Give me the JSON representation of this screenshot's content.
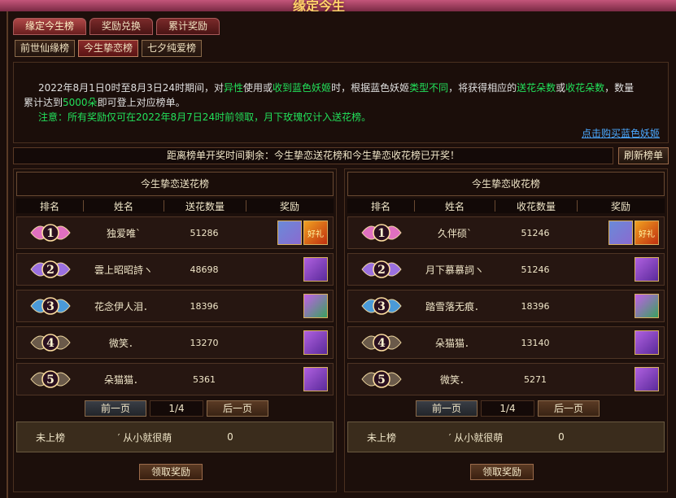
{
  "banner_title": "缘定今生",
  "tabs_primary": [
    {
      "label": "缘定今生榜",
      "active": true
    },
    {
      "label": "奖励兑换",
      "active": false
    },
    {
      "label": "累计奖励",
      "active": false
    }
  ],
  "tabs_secondary": [
    {
      "label": "前世仙缘榜",
      "active": false
    },
    {
      "label": "今生挚恋榜",
      "active": true
    },
    {
      "label": "七夕纯爱榜",
      "active": false
    }
  ],
  "info": {
    "line1_a": "2022年8月1日0时至8月3日24时期间，对",
    "line1_b": "异性",
    "line1_c": "使用",
    "line1_d": "或",
    "line1_e": "收到",
    "line1_f": "蓝色妖姬",
    "line1_g": "时，根据蓝色妖姬",
    "line1_h": "类型不同",
    "line1_i": "，将获得相应的",
    "line1_j": "送花朵数",
    "line1_k": "或",
    "line1_l": "收花朵数",
    "line1_m": "，数量",
    "line2_a": "累计达到",
    "line2_b": "5000朵",
    "line2_c": "即可登上对应榜单。",
    "line3": "注意：所有奖励仅可在2022年8月7日24时前领取，月下玫瑰仅计入送花榜。",
    "buy_link": "点击购买蓝色妖姬"
  },
  "countdown_text": "距离榜单开奖时间剩余：今生挚恋送花榜和今生挚恋收花榜已开奖！",
  "refresh_label": "刷新榜单",
  "panels": [
    {
      "title": "今生挚恋送花榜",
      "headers": [
        "排名",
        "姓名",
        "送花数量",
        "奖励"
      ],
      "rows": [
        {
          "rank": "1",
          "name": "独爱唯ˋ",
          "count": "51286",
          "rewards": [
            "gold",
            "fire"
          ]
        },
        {
          "rank": "2",
          "name": "雲上昭昭詩ヽ",
          "count": "48698",
          "rewards": [
            "box"
          ]
        },
        {
          "rank": "3",
          "name": "花念伊人泪．",
          "count": "18396",
          "rewards": [
            "green"
          ]
        },
        {
          "rank": "4",
          "name": "微笑．",
          "count": "13270",
          "rewards": [
            "box"
          ]
        },
        {
          "rank": "5",
          "name": "朵猫猫．",
          "count": "5361",
          "rewards": [
            "box"
          ]
        }
      ],
      "pager": {
        "prev": "前一页",
        "page": "1/4",
        "next": "后一页"
      },
      "self": {
        "status": "未上榜",
        "name": "′ 从小就很萌",
        "count": "0"
      },
      "claim": "领取奖励"
    },
    {
      "title": "今生挚恋收花榜",
      "headers": [
        "排名",
        "姓名",
        "收花数量",
        "奖励"
      ],
      "rows": [
        {
          "rank": "1",
          "name": "久伴硕ˋ",
          "count": "51246",
          "rewards": [
            "gold",
            "fire"
          ]
        },
        {
          "rank": "2",
          "name": "月下慕慕詞ヽ",
          "count": "51246",
          "rewards": [
            "box"
          ]
        },
        {
          "rank": "3",
          "name": "踏雪落无痕．",
          "count": "18396",
          "rewards": [
            "green"
          ]
        },
        {
          "rank": "4",
          "name": "朵猫猫．",
          "count": "13140",
          "rewards": [
            "box"
          ]
        },
        {
          "rank": "5",
          "name": "微笑．",
          "count": "5271",
          "rewards": [
            "box"
          ]
        }
      ],
      "pager": {
        "prev": "前一页",
        "page": "1/4",
        "next": "后一页"
      },
      "self": {
        "status": "未上榜",
        "name": "′ 从小就很萌",
        "count": "0"
      },
      "claim": "领取奖励"
    }
  ],
  "reward_glyphs": {
    "fire": "好礼"
  },
  "colors": {
    "rank1": "#e070c0",
    "rank2": "#9a70e0",
    "rank3": "#4a9ad8",
    "rank_other": "#6a5a4a",
    "highlight_green": "#22e05a",
    "link_blue": "#4aa8ff"
  }
}
